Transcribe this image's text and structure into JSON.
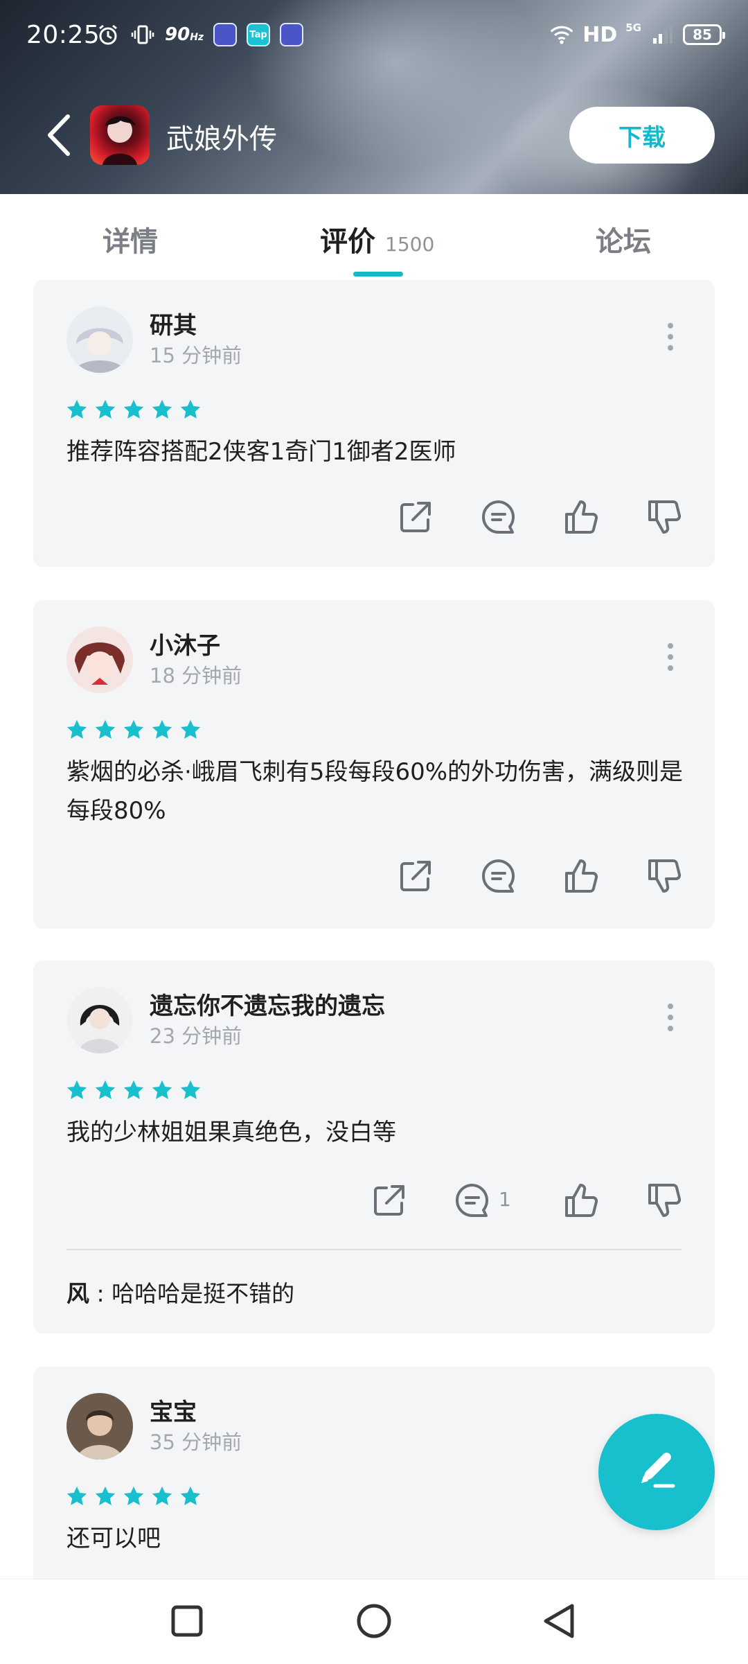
{
  "status_bar": {
    "time": "20:25",
    "refresh_rate": "90",
    "refresh_unit": "Hz",
    "tap_label": "Tap",
    "network": "HD",
    "network_gen": "5G",
    "battery": "85"
  },
  "header": {
    "game_title": "武娘外传",
    "download_label": "下载"
  },
  "tabs": [
    {
      "label": "详情"
    },
    {
      "label": "评价",
      "count": "1500",
      "active": true
    },
    {
      "label": "论坛"
    }
  ],
  "reviews": [
    {
      "username": "研其",
      "time": "15 分钟前",
      "rating": 5,
      "content": "推荐阵容搭配2侠客1奇门1御者2医师"
    },
    {
      "username": "小沐子",
      "time": "18 分钟前",
      "rating": 5,
      "content": "紫烟的必杀·峨眉飞刺有5段每段60%的外功伤害，满级则是每段80%"
    },
    {
      "username": "遗忘你不遗忘我的遗忘",
      "time": "23 分钟前",
      "rating": 5,
      "content": "我的少林姐姐果真绝色，没白等",
      "comment_count": "1",
      "reply": {
        "author": "风",
        "separator": " : ",
        "text": "哈哈哈是挺不错的"
      }
    },
    {
      "username": "宝宝",
      "time": "35 分钟前",
      "rating": 5,
      "content": "还可以吧"
    }
  ],
  "colors": {
    "accent": "#18bfcd",
    "card_bg": "#f4f5f7",
    "muted_text": "#a3a8ae"
  }
}
